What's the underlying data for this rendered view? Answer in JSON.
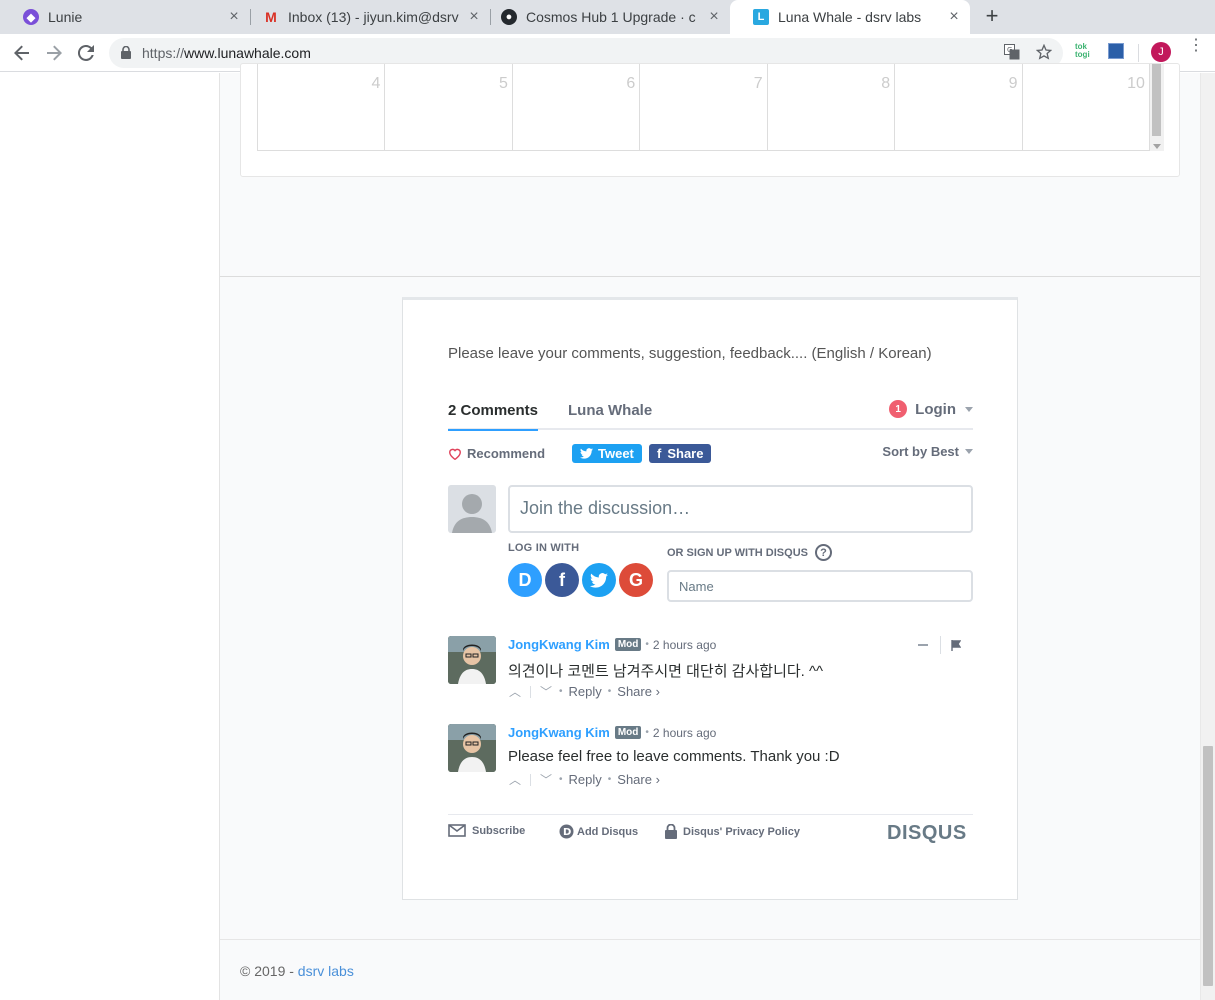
{
  "browser": {
    "tabs": [
      {
        "title": "Lunie",
        "icon": "lunie-icon",
        "active": false
      },
      {
        "title": "Inbox (13) - jiyun.kim@dsrv",
        "icon": "gmail-icon",
        "active": false
      },
      {
        "title": "Cosmos Hub 1 Upgrade · c",
        "icon": "github-icon",
        "active": false
      },
      {
        "title": "Luna Whale - dsrv labs",
        "icon": "lunawhale-icon",
        "active": true
      }
    ],
    "url_scheme": "https://",
    "url_host": "www.lunawhale.com",
    "ext_toktogi": "tok togi",
    "profile_initial": "J"
  },
  "calendar": {
    "days": [
      "4",
      "5",
      "6",
      "7",
      "8",
      "9",
      "10"
    ]
  },
  "disqus": {
    "intro": "Please leave your comments, suggestion, feedback.... (English / Korean)",
    "tab_comments": "2 Comments",
    "tab_site": "Luna Whale",
    "notification_count": "1",
    "login": "Login",
    "recommend": "Recommend",
    "tweet": "Tweet",
    "share": "Share",
    "sort": "Sort by Best",
    "join_placeholder": "Join the discussion…",
    "log_in_with": "LOG IN WITH",
    "social": [
      "D",
      "f",
      "t",
      "G"
    ],
    "signup_label": "OR SIGN UP WITH DISQUS",
    "name_placeholder": "Name",
    "comments": [
      {
        "author": "JongKwang Kim",
        "badge": "Mod",
        "time": "2 hours ago",
        "body": "의견이나 코멘트 남겨주시면 대단히 감사합니다. ^^",
        "reply": "Reply",
        "share": "Share ›"
      },
      {
        "author": "JongKwang Kim",
        "badge": "Mod",
        "time": "2 hours ago",
        "body": "Please feel free to leave comments. Thank you :D",
        "reply": "Reply",
        "share": "Share ›"
      }
    ],
    "footer": {
      "subscribe": "Subscribe",
      "add_disqus": "Add Disqus",
      "privacy": "Disqus' Privacy Policy",
      "logo": "DISQUS"
    }
  },
  "page_footer": {
    "copyright": "© 2019 - ",
    "link": "dsrv labs"
  },
  "colors": {
    "accent": "#2e9fff",
    "twitter": "#1da1f2",
    "facebook": "#3b5998",
    "google": "#dd4b39"
  }
}
